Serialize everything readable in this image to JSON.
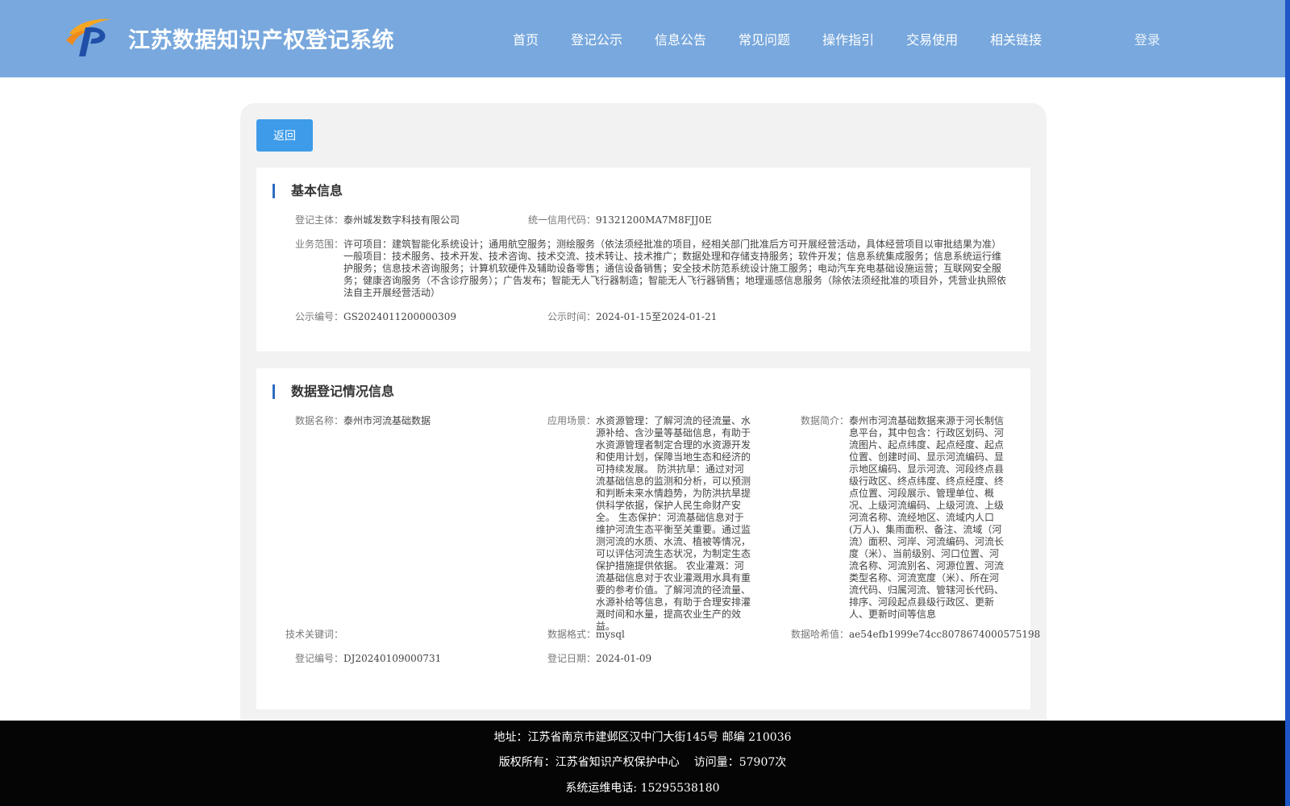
{
  "header": {
    "site_title": "江苏数据知识产权登记系统",
    "nav": [
      "首页",
      "登记公示",
      "信息公告",
      "常见问题",
      "操作指引",
      "交易使用",
      "相关链接"
    ],
    "login": "登录"
  },
  "toolbar": {
    "back_label": "返回"
  },
  "basic_info": {
    "title": "基本信息",
    "subject_label": "登记主体：",
    "subject_value": "泰州城发数字科技有限公司",
    "credit_label": "统一信用代码：",
    "credit_value": "91321200MA7M8FJJ0E",
    "scope_label": "业务范围：",
    "scope_value": "许可项目：建筑智能化系统设计；通用航空服务；测绘服务（依法须经批准的项目，经相关部门批准后方可开展经营活动，具体经营项目以审批结果为准）一般项目：技术服务、技术开发、技术咨询、技术交流、技术转让、技术推广；数据处理和存储支持服务；软件开发；信息系统集成服务；信息系统运行维护服务；信息技术咨询服务；计算机软硬件及辅助设备零售；通信设备销售；安全技术防范系统设计施工服务；电动汽车充电基础设施运营；互联网安全服务；健康咨询服务（不含诊疗服务）；广告发布；智能无人飞行器制造；智能无人飞行器销售；地理遥感信息服务（除依法须经批准的项目外，凭营业执照依法自主开展经营活动）",
    "pub_no_label": "公示编号：",
    "pub_no_value": "GS2024011200000309",
    "pub_time_label": "公示时间：",
    "pub_time_value": "2024-01-15至2024-01-21"
  },
  "data_info": {
    "title": "数据登记情况信息",
    "name_label": "数据名称：",
    "name_value": "泰州市河流基础数据",
    "scene_label": "应用场景：",
    "scene_value": "水资源管理：了解河流的径流量、水源补给、含沙量等基础信息，有助于水资源管理者制定合理的水资源开发和使用计划，保障当地生态和经济的可持续发展。 防洪抗旱：通过对河流基础信息的监测和分析，可以预测和判断未来水情趋势，为防洪抗旱提供科学依据，保护人民生命财产安全。 生态保护：河流基础信息对于维护河流生态平衡至关重要。通过监测河流的水质、水流、植被等情况，可以评估河流生态状况，为制定生态保护措施提供依据。 农业灌溉：河流基础信息对于农业灌溉用水具有重要的参考价值。了解河流的径流量、水源补给等信息，有助于合理安排灌溉时间和水量，提高农业生产的效益。",
    "intro_label": "数据简介：",
    "intro_value": "泰州市河流基础数据来源于河长制信息平台，其中包含：行政区划码、河流图片、起点纬度、起点经度、起点位置、创建时间、显示河流编码、显示地区编码、显示河流、河段终点县级行政区、终点纬度、终点经度、终点位置、河段展示、管理单位、概况、上级河流编码、上级河流、上级河流名称、流经地区、流域内人口(万人)、集雨面积、备注、流域（河流）面积、河岸、河流编码、河流长度（米）、当前级别、河口位置、河流名称、河流别名、河源位置、河流类型名称、河流宽度（米）、所在河流代码、归属河流、管辖河长代码、排序、河段起点县级行政区、更新人、更新时间等信息",
    "keyword_label": "技术关键词：",
    "keyword_value": "",
    "format_label": "数据格式：",
    "format_value": "mysql",
    "hash_label": "数据哈希值：",
    "hash_value": "ae54efb1999e74cc8078674000575198",
    "reg_no_label": "登记编号：",
    "reg_no_value": "DJ20240109000731",
    "reg_date_label": "登记日期：",
    "reg_date_value": "2024-01-09"
  },
  "footer": {
    "address": "地址：江苏省南京市建邺区汉中门大街145号 邮编 210036",
    "copyright": "版权所有：江苏省知识产权保护中心",
    "visits": "访问量：57907次",
    "phone": "系统运维电话: 15295538180"
  }
}
